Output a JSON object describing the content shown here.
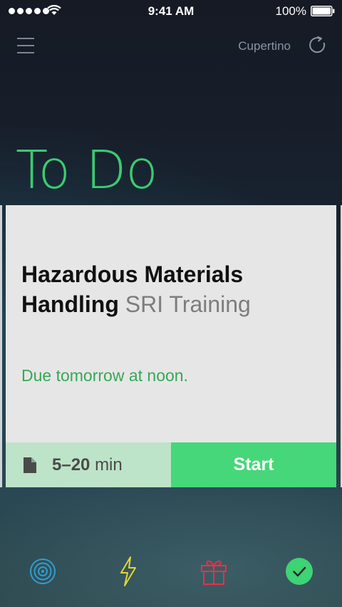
{
  "status_bar": {
    "time": "9:41 AM",
    "battery": "100%",
    "icons": [
      "signal-dots-icon",
      "wifi-icon",
      "battery-icon"
    ]
  },
  "nav": {
    "menu_icon": "hamburger-menu-icon",
    "location": "Cupertino",
    "refresh_icon": "refresh-icon"
  },
  "page_title": "To Do",
  "card": {
    "course_name": "Hazardous Materials Handling",
    "course_type": "SRI Training",
    "due": "Due tomorrow at noon.",
    "duration_value": "5–20",
    "duration_unit": "min",
    "duration_icon": "document-icon",
    "start_label": "Start"
  },
  "tabs": [
    {
      "name": "target-icon",
      "color": "#2e9ecf"
    },
    {
      "name": "lightning-icon",
      "color": "#e4d43a"
    },
    {
      "name": "gift-icon",
      "color": "#e8304a"
    },
    {
      "name": "check-circle-icon",
      "color": "#3ed374"
    }
  ],
  "colors": {
    "accent_green": "#3ed374",
    "start_button": "#45d779",
    "duration_bg": "#bde3c8",
    "due_text": "#36a856"
  }
}
